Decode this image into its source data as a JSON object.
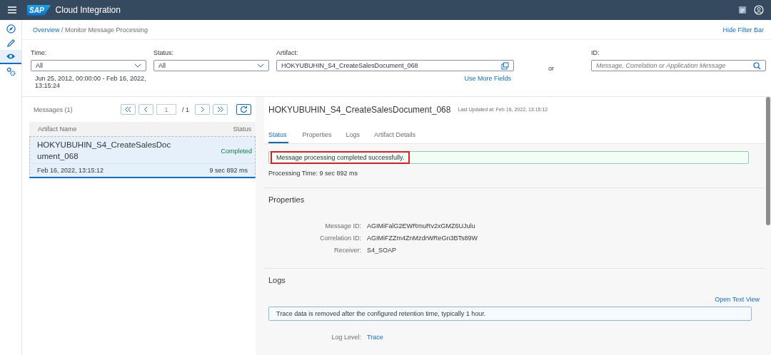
{
  "header": {
    "logo": "SAP",
    "title": "Cloud Integration"
  },
  "nav": [
    {
      "kind": "monitor",
      "selected": false
    },
    {
      "kind": "design",
      "selected": false
    },
    {
      "kind": "view",
      "selected": true
    },
    {
      "kind": "settings",
      "selected": false
    }
  ],
  "breadcrumb": {
    "link": "Overview",
    "current": "/ Monitor Message Processing"
  },
  "hide_filter_bar": "Hide Filter Bar",
  "filters": {
    "time": {
      "label": "Time:",
      "value": "All",
      "range": "Jun 25, 2012, 00:00:00 - Feb 16, 2022, 13:15:24"
    },
    "status": {
      "label": "Status:",
      "value": "All"
    },
    "artifact": {
      "label": "Artifact:",
      "value": "HOKYUBUHIN_S4_CreateSalesDocument_068"
    },
    "or": "or",
    "id": {
      "label": "ID:",
      "placeholder": "Message, Correlation or Application Message"
    },
    "more": "Use More Fields"
  },
  "messages": {
    "title": "Messages (1)",
    "page": "1",
    "pages": "/  1",
    "columns": [
      "Artifact Name",
      "Status"
    ],
    "rows": [
      {
        "name": "HOKYUBUHIN_S4_CreateSalesDocument_068",
        "status": "Completed",
        "time": "Feb 16, 2022, 13:15:12",
        "duration": "9 sec 892 ms",
        "selected": true
      }
    ]
  },
  "detail": {
    "title": "HOKYUBUHIN_S4_CreateSalesDocument_068",
    "updated": "Last Updated at: Feb 16, 2022, 13:15:12",
    "tabs": [
      {
        "label": "Status",
        "selected": true
      },
      {
        "label": "Properties",
        "selected": false
      },
      {
        "label": "Logs",
        "selected": false
      },
      {
        "label": "Artifact Details",
        "selected": false
      }
    ],
    "status_message": "Message processing completed successfully.",
    "processing_time": "Processing Time: 9 sec 892 ms",
    "properties": {
      "title": "Properties",
      "fields": [
        {
          "label": "Message ID:",
          "value": "AGIMiFalG2EWRmuRv2xGMZ6UJulu"
        },
        {
          "label": "Correlation ID:",
          "value": "AGIMiFZZm4ZnMzdrWReGn3BTs89W"
        },
        {
          "label": "Receiver:",
          "value": "S4_SOAP"
        }
      ]
    },
    "logs": {
      "title": "Logs",
      "open_text_view": "Open Text View",
      "info": "Trace data is removed after the configured retention time, typically 1 hour.",
      "level_label": "Log Level:",
      "level_value": "Trace"
    }
  }
}
